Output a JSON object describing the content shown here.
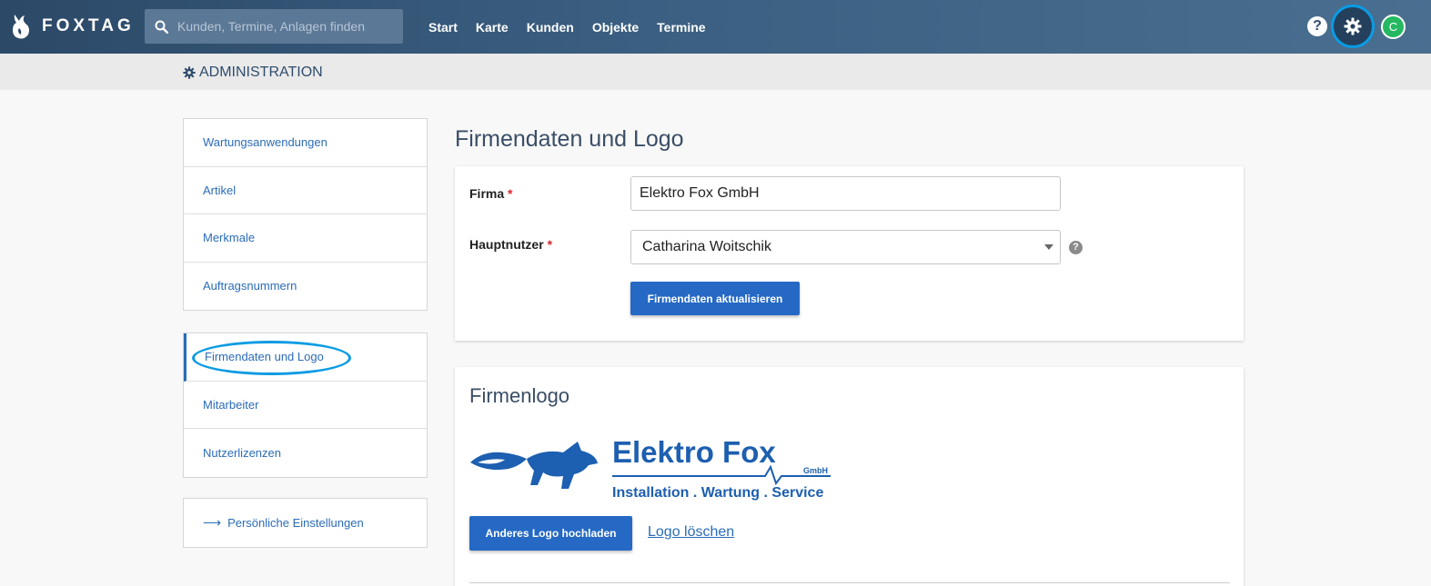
{
  "app": {
    "brand": "FOXTAG"
  },
  "search": {
    "placeholder": "Kunden, Termine, Anlagen finden"
  },
  "nav": [
    "Start",
    "Karte",
    "Kunden",
    "Objekte",
    "Termine"
  ],
  "user": {
    "avatar_initial": "C"
  },
  "help": {
    "symbol": "?"
  },
  "admin": {
    "title": "ADMINISTRATION"
  },
  "sidebar": {
    "group1": [
      "Wartungsanwendungen",
      "Artikel",
      "Merkmale",
      "Auftragsnummern"
    ],
    "group2": [
      "Firmendaten und Logo",
      "Mitarbeiter",
      "Nutzerlizenzen"
    ],
    "group3": {
      "arrow": "⟶",
      "label": "Persönliche Einstellungen"
    },
    "active": "Firmendaten und Logo"
  },
  "main": {
    "title": "Firmendaten und Logo",
    "form": {
      "firma_label": "Firma",
      "firma_value": "Elektro Fox GmbH",
      "hauptnutzer_label": "Hauptnutzer",
      "hauptnutzer_value": "Catharina Woitschik",
      "required_mark": "*",
      "help_symbol": "?",
      "submit_label": "Firmendaten aktualisieren"
    },
    "logo_section": {
      "title": "Firmenlogo",
      "logo_text_main": "Elektro Fox",
      "logo_text_gmbh": "GmbH",
      "logo_tagline": "Installation . Wartung . Service",
      "upload_label": "Anderes Logo hochladen",
      "delete_label": "Logo löschen"
    }
  },
  "colors": {
    "accent": "#2569c4",
    "highlight": "#0a9be3",
    "nav_bg": "#2c4967",
    "avatar": "#25b861"
  }
}
